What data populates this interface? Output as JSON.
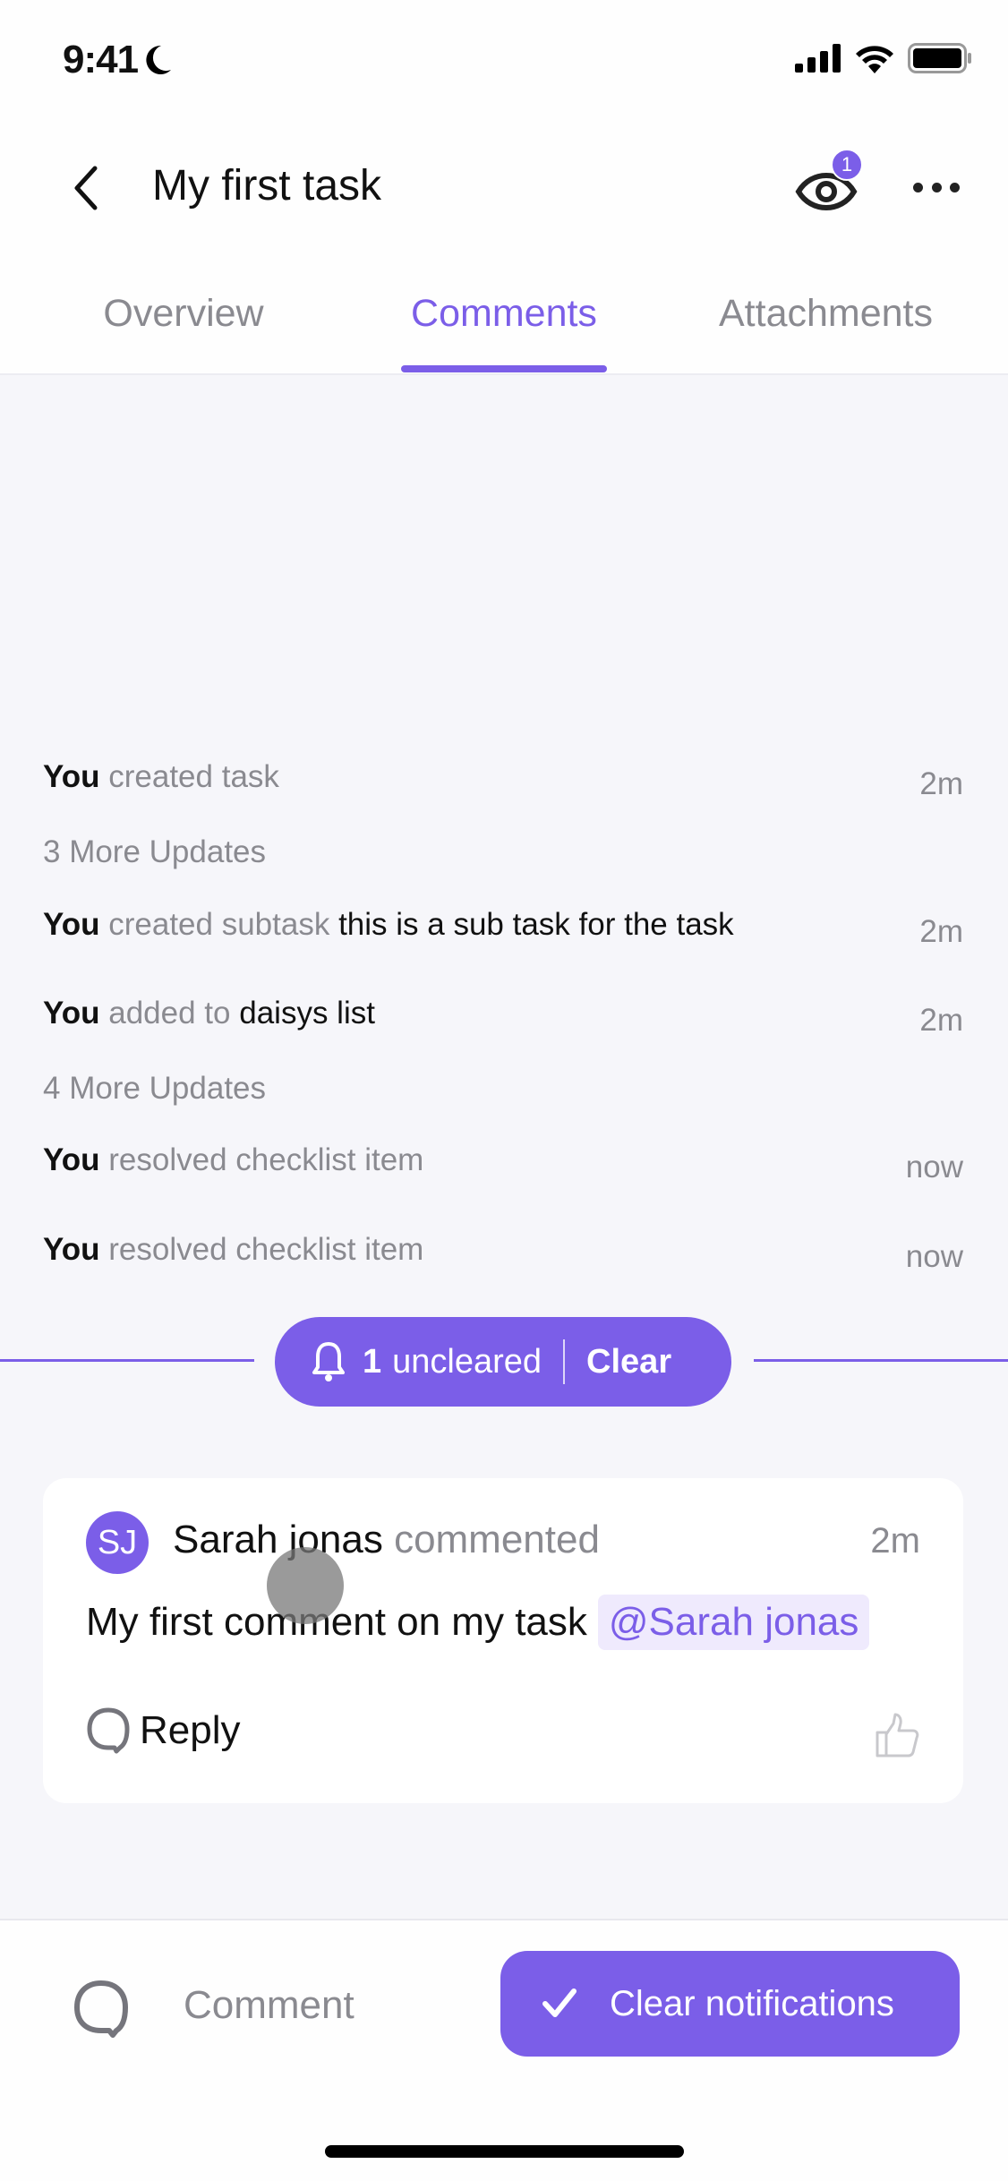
{
  "status_bar": {
    "time": "9:41",
    "icons": [
      "moon-icon",
      "signal-icon",
      "wifi-icon",
      "battery-icon"
    ]
  },
  "header": {
    "title": "My first task",
    "watchers_badge": "1",
    "icons": [
      "back-chevron-icon",
      "eye-icon",
      "more-dots-icon"
    ]
  },
  "tabs": [
    {
      "label": "Overview",
      "active": false
    },
    {
      "label": "Comments",
      "active": true
    },
    {
      "label": "Attachments",
      "active": false
    }
  ],
  "activity": [
    {
      "type": "event",
      "actor": "You",
      "action": "created task",
      "object": "",
      "time": "2m"
    },
    {
      "type": "more",
      "label": "3 More Updates"
    },
    {
      "type": "event",
      "actor": "You",
      "action": "created subtask",
      "object": "this is a sub task for the task",
      "time": "2m"
    },
    {
      "type": "event",
      "actor": "You",
      "action": "added to",
      "object": "daisys list",
      "time": "2m"
    },
    {
      "type": "more",
      "label": "4 More Updates"
    },
    {
      "type": "event",
      "actor": "You",
      "action": "resolved checklist item",
      "object": "",
      "time": "now"
    },
    {
      "type": "event",
      "actor": "You",
      "action": "resolved checklist item",
      "object": "",
      "time": "now"
    }
  ],
  "uncleared_pill": {
    "count": "1",
    "label": "uncleared",
    "clear_label": "Clear"
  },
  "comment": {
    "avatar_initials": "SJ",
    "author": "Sarah jonas",
    "verb": "commented",
    "time": "2m",
    "text": "My first comment on my task",
    "mention": "@Sarah jonas",
    "reply_label": "Reply"
  },
  "bottom_bar": {
    "comment_placeholder": "Comment",
    "clear_notifications_label": "Clear notifications"
  },
  "colors": {
    "accent": "#7b5ee8",
    "background": "#f6f6fa",
    "muted_text": "#8a8a90",
    "mention_bg": "#efeafd"
  }
}
